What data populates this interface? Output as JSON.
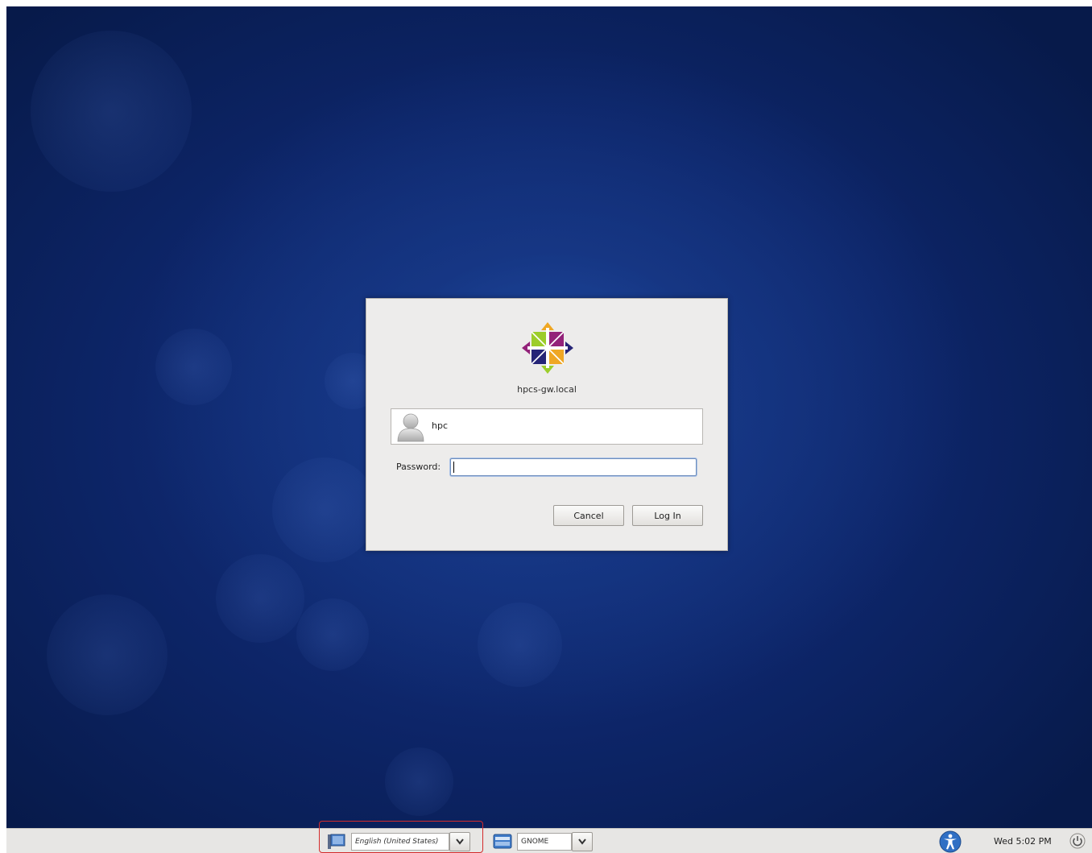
{
  "login": {
    "hostname": "hpcs-gw.local",
    "username": "hpc",
    "password_label": "Password:",
    "password_value": "",
    "cancel_label": "Cancel",
    "login_label": "Log In"
  },
  "panel": {
    "language": "English (United States)",
    "session": "GNOME",
    "clock": "Wed 5:02 PM"
  },
  "icons": {
    "logo": "centos-logo",
    "user": "user-avatar-icon",
    "language": "language-flag-icon",
    "session": "session-icon",
    "accessibility": "accessibility-icon",
    "power": "power-icon"
  },
  "colors": {
    "desktop": "#0d2568",
    "dialog": "#edeceb",
    "panel": "#e7e6e4",
    "highlight": "#d42b2b"
  }
}
